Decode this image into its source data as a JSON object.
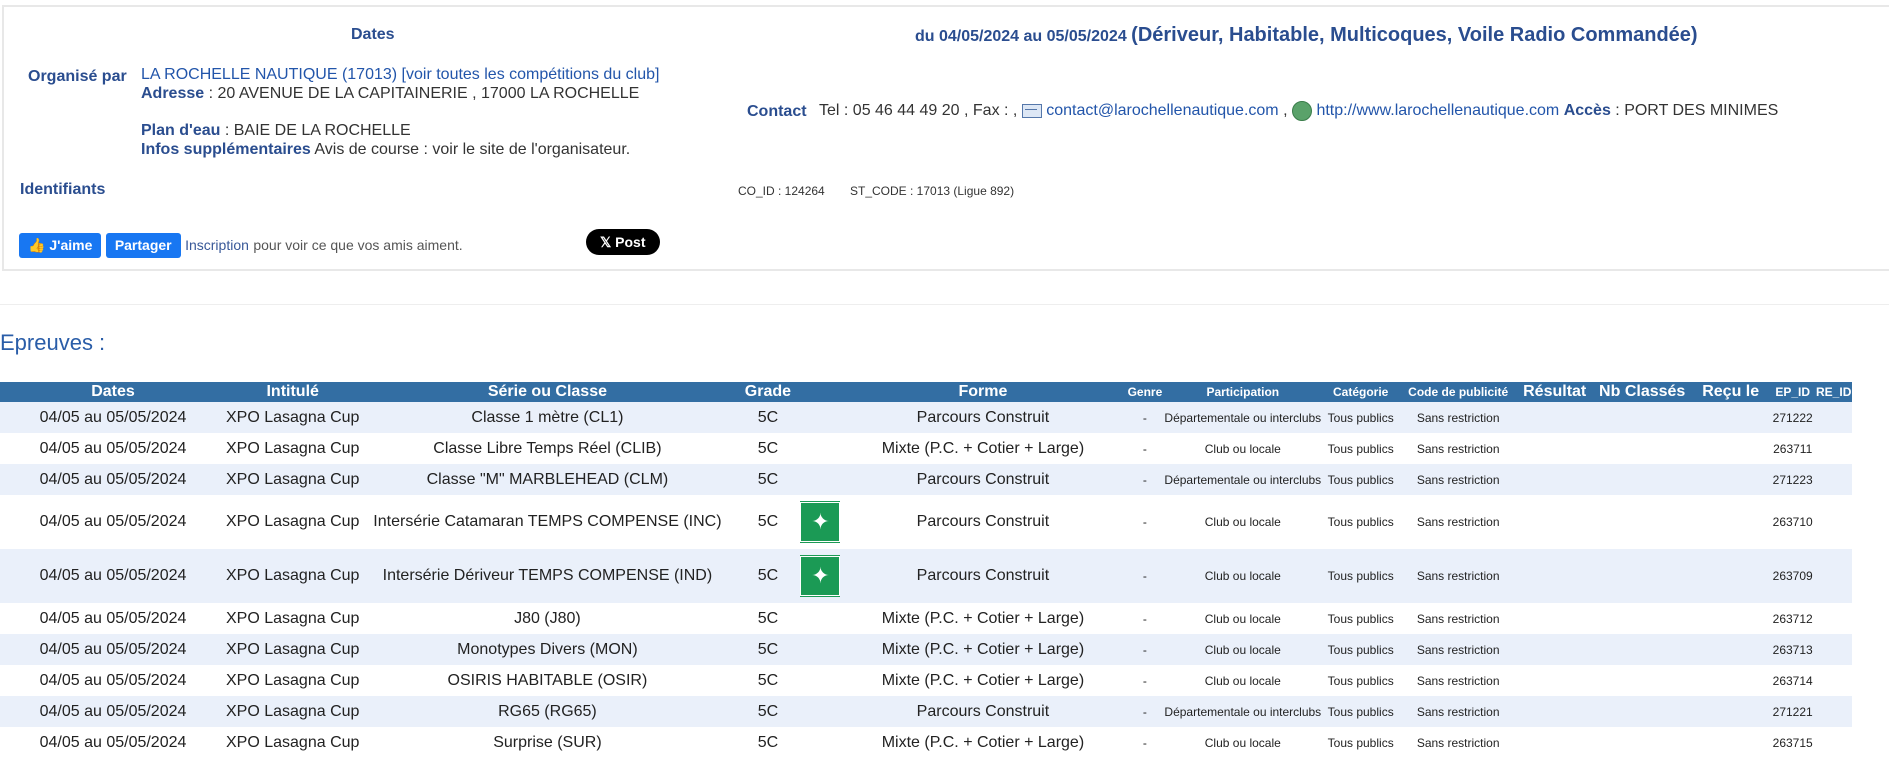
{
  "header": {
    "dates_label": "Dates",
    "dates_value": "du 04/05/2024  au 05/05/2024",
    "dates_types": "(Dériveur, Habitable, Multicoques, Voile Radio Commandée)",
    "organise_label": "Organisé par",
    "club_link": "LA ROCHELLE NAUTIQUE (17013)",
    "all_comps_link": "[voir toutes les compétitions du club]",
    "adresse_label": "Adresse",
    "adresse_value": ": 20 AVENUE DE LA CAPITAINERIE , 17000 LA ROCHELLE",
    "plan_label": "Plan d'eau",
    "plan_value": ": BAIE DE LA ROCHELLE",
    "infos_label": "Infos supplémentaires",
    "infos_value": "Avis de course : voir le site de l'organisateur.",
    "contact_label": "Contact",
    "tel_text": "Tel : 05 46 44 49 20 , Fax : ,",
    "email_link": "contact@larochellenautique.com",
    "comma": ",",
    "web_link": "http://www.larochellenautique.com",
    "acces_label": "Accès",
    "acces_value": ": PORT DES MINIMES",
    "identifiants_label": "Identifiants",
    "co_id": "CO_ID : 124264",
    "st_code": "ST_CODE : 17013 (Ligue 892)"
  },
  "social": {
    "like_label": "J'aime",
    "share_label": "Partager",
    "inscription_link": "Inscription",
    "friends_text": "pour voir ce que vos amis aiment.",
    "x_post_label": "Post"
  },
  "epreuves": {
    "title": "Epreuves :",
    "columns": [
      "Dates",
      "Intitulé",
      "Série ou Classe",
      "Grade",
      "",
      "Forme",
      "Genre",
      "Participation",
      "Catégorie",
      "Code de publicité",
      "Résultat",
      "Nb Classés",
      "Reçu le",
      "EP_ID",
      "RE_ID"
    ],
    "rows": [
      {
        "dates": "04/05 au 05/05/2024",
        "intitule": "XPO Lasagna Cup",
        "serie": "Classe 1 mètre (CL1)",
        "grade": "5C",
        "icon": "",
        "forme": "Parcours Construit",
        "genre": "-",
        "participation": "Départementale ou interclubs",
        "categorie": "Tous publics",
        "pub": "Sans restriction",
        "resultat": "",
        "nb": "",
        "recu": "",
        "ep_id": "271222",
        "re_id": ""
      },
      {
        "dates": "04/05 au 05/05/2024",
        "intitule": "XPO Lasagna Cup",
        "serie": "Classe Libre Temps Réel (CLIB)",
        "grade": "5C",
        "icon": "",
        "forme": "Mixte (P.C. + Cotier + Large)",
        "genre": "-",
        "participation": "Club ou locale",
        "categorie": "Tous publics",
        "pub": "Sans restriction",
        "resultat": "",
        "nb": "",
        "recu": "",
        "ep_id": "263711",
        "re_id": ""
      },
      {
        "dates": "04/05 au 05/05/2024",
        "intitule": "XPO Lasagna Cup",
        "serie": "Classe \"M\" MARBLEHEAD (CLM)",
        "grade": "5C",
        "icon": "",
        "forme": "Parcours Construit",
        "genre": "-",
        "participation": "Départementale ou interclubs",
        "categorie": "Tous publics",
        "pub": "Sans restriction",
        "resultat": "",
        "nb": "",
        "recu": "",
        "ep_id": "271223",
        "re_id": ""
      },
      {
        "dates": "04/05 au 05/05/2024",
        "intitule": "XPO Lasagna Cup",
        "serie": "Intersérie Catamaran TEMPS COMPENSE (INC)",
        "grade": "5C",
        "icon": "assembly-point-icon",
        "forme": "Parcours Construit",
        "genre": "-",
        "participation": "Club ou locale",
        "categorie": "Tous publics",
        "pub": "Sans restriction",
        "resultat": "",
        "nb": "",
        "recu": "",
        "ep_id": "263710",
        "re_id": ""
      },
      {
        "dates": "04/05 au 05/05/2024",
        "intitule": "XPO Lasagna Cup",
        "serie": "Intersérie Dériveur TEMPS COMPENSE (IND)",
        "grade": "5C",
        "icon": "assembly-point-icon",
        "forme": "Parcours Construit",
        "genre": "-",
        "participation": "Club ou locale",
        "categorie": "Tous publics",
        "pub": "Sans restriction",
        "resultat": "",
        "nb": "",
        "recu": "",
        "ep_id": "263709",
        "re_id": ""
      },
      {
        "dates": "04/05 au 05/05/2024",
        "intitule": "XPO Lasagna Cup",
        "serie": "J80 (J80)",
        "grade": "5C",
        "icon": "",
        "forme": "Mixte (P.C. + Cotier + Large)",
        "genre": "-",
        "participation": "Club ou locale",
        "categorie": "Tous publics",
        "pub": "Sans restriction",
        "resultat": "",
        "nb": "",
        "recu": "",
        "ep_id": "263712",
        "re_id": ""
      },
      {
        "dates": "04/05 au 05/05/2024",
        "intitule": "XPO Lasagna Cup",
        "serie": "Monotypes Divers (MON)",
        "grade": "5C",
        "icon": "",
        "forme": "Mixte (P.C. + Cotier + Large)",
        "genre": "-",
        "participation": "Club ou locale",
        "categorie": "Tous publics",
        "pub": "Sans restriction",
        "resultat": "",
        "nb": "",
        "recu": "",
        "ep_id": "263713",
        "re_id": ""
      },
      {
        "dates": "04/05 au 05/05/2024",
        "intitule": "XPO Lasagna Cup",
        "serie": "OSIRIS HABITABLE (OSIR)",
        "grade": "5C",
        "icon": "",
        "forme": "Mixte (P.C. + Cotier + Large)",
        "genre": "-",
        "participation": "Club ou locale",
        "categorie": "Tous publics",
        "pub": "Sans restriction",
        "resultat": "",
        "nb": "",
        "recu": "",
        "ep_id": "263714",
        "re_id": ""
      },
      {
        "dates": "04/05 au 05/05/2024",
        "intitule": "XPO Lasagna Cup",
        "serie": "RG65 (RG65)",
        "grade": "5C",
        "icon": "",
        "forme": "Parcours Construit",
        "genre": "-",
        "participation": "Départementale ou interclubs",
        "categorie": "Tous publics",
        "pub": "Sans restriction",
        "resultat": "",
        "nb": "",
        "recu": "",
        "ep_id": "271221",
        "re_id": ""
      },
      {
        "dates": "04/05 au 05/05/2024",
        "intitule": "XPO Lasagna Cup",
        "serie": "Surprise (SUR)",
        "grade": "5C",
        "icon": "",
        "forme": "Mixte (P.C. + Cotier + Large)",
        "genre": "-",
        "participation": "Club ou locale",
        "categorie": "Tous publics",
        "pub": "Sans restriction",
        "resultat": "",
        "nb": "",
        "recu": "",
        "ep_id": "263715",
        "re_id": ""
      }
    ]
  },
  "colors": {
    "header_bg": "#336ea3",
    "row_alt": "#eaf0fa",
    "label": "#2a4d8f",
    "link": "#2255aa",
    "facebook": "#1877f2",
    "icon_green": "#1b9a55"
  }
}
